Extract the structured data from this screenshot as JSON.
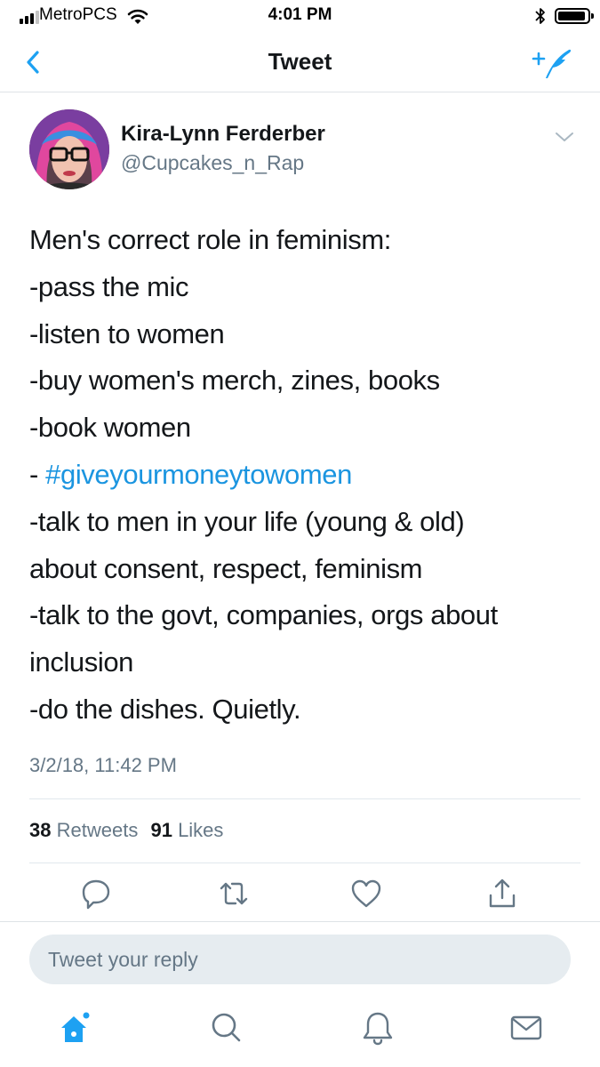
{
  "status_bar": {
    "carrier": "MetroPCS",
    "time": "4:01 PM",
    "icons": [
      "signal-icon",
      "wifi-icon",
      "bluetooth-icon",
      "battery-icon"
    ]
  },
  "nav": {
    "title": "Tweet",
    "back_icon": "chevron-left-icon",
    "compose_icon": "compose-tweet-icon"
  },
  "tweet": {
    "author_name": "Kira-Lynn Ferderber",
    "author_handle": "@Cupcakes_n_Rap",
    "lines": [
      "Men's correct role in feminism:",
      "-pass the mic",
      "-listen to women",
      "-buy women's merch, zines, books",
      "-book women"
    ],
    "hashtag_prefix": "- ",
    "hashtag": "#giveyourmoneytowomen",
    "lines_after": [
      "-talk to men in your life (young & old)",
      "about consent, respect, feminism",
      "-talk to the govt, companies, orgs about",
      "inclusion",
      "-do the dishes. Quietly."
    ],
    "timestamp": "3/2/18, 11:42 PM",
    "retweets_count": "38",
    "retweets_label": "Retweets",
    "likes_count": "91",
    "likes_label": "Likes"
  },
  "actions": [
    "reply-icon",
    "retweet-icon",
    "like-icon",
    "share-icon"
  ],
  "reply": {
    "placeholder": "Tweet your reply"
  },
  "tab_bar": [
    "home-icon",
    "search-icon",
    "notifications-icon",
    "messages-icon"
  ],
  "colors": {
    "accent": "#1da1f2",
    "hashtag": "#1b95e0",
    "secondary_text": "#657786",
    "primary_text": "#14171a",
    "reply_background": "#e6ecf0"
  }
}
